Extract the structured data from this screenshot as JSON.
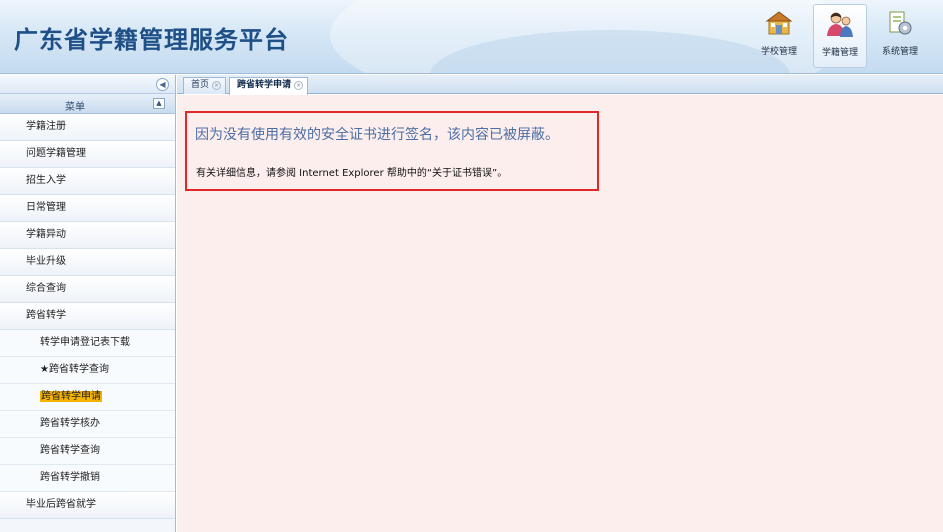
{
  "header": {
    "title": "广东省学籍管理服务平台",
    "nav": [
      {
        "label": "学校管理",
        "icon": "school-management-icon"
      },
      {
        "label": "学籍管理",
        "icon": "student-management-icon",
        "active": true
      },
      {
        "label": "系统管理",
        "icon": "system-management-icon"
      }
    ]
  },
  "sidebar": {
    "menu_title": "菜单",
    "collapse_icon": "◀",
    "toggle_icon": "▲",
    "items": [
      {
        "label": "学籍注册"
      },
      {
        "label": "问题学籍管理"
      },
      {
        "label": "招生入学"
      },
      {
        "label": "日常管理"
      },
      {
        "label": "学籍异动"
      },
      {
        "label": "毕业升级"
      },
      {
        "label": "综合查询"
      },
      {
        "label": "跨省转学"
      }
    ],
    "sub_items": [
      {
        "label": "转学申请登记表下载"
      },
      {
        "label": "★跨省转学查询"
      },
      {
        "label": "跨省转学申请",
        "selected": true
      },
      {
        "label": "跨省转学核办"
      },
      {
        "label": "跨省转学查询"
      },
      {
        "label": "跨省转学撤销"
      }
    ],
    "last_item": {
      "label": "毕业后跨省就学"
    }
  },
  "tabs": [
    {
      "label": "首页",
      "active": false
    },
    {
      "label": "跨省转学申请",
      "active": true
    }
  ],
  "tab_close_glyph": "×",
  "content": {
    "error_title": "因为没有使用有效的安全证书进行签名，该内容已被屏蔽。",
    "error_detail": "有关详细信息，请参阅 Internet Explorer 帮助中的“关于证书错误”。"
  },
  "colors": {
    "header_title": "#1e4f86",
    "content_bg": "#fdeeee",
    "error_border": "#e02828",
    "error_title": "#4b6ea4",
    "selected_highlight": "#f6b400"
  }
}
